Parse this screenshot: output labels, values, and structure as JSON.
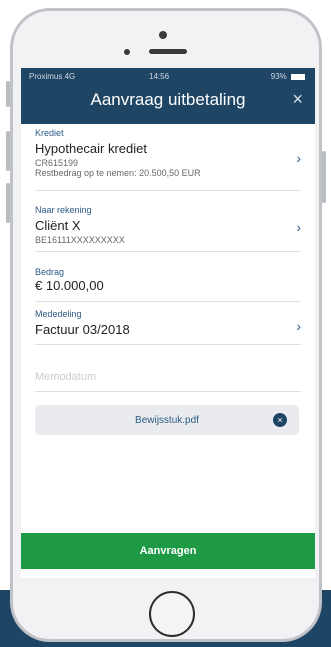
{
  "status_bar": {
    "carrier": "Proximus 4G",
    "time": "14:56",
    "battery": "93%"
  },
  "header": {
    "title": "Aanvraag uitbetaling",
    "close_icon": "×"
  },
  "form": {
    "krediet": {
      "label": "Krediet",
      "value": "Hypothecair krediet",
      "account": "CR615199",
      "remaining": "Restbedrag op te nemen: 20.500,50 EUR"
    },
    "naar_rekening": {
      "label": "Naar rekening",
      "value": "Cliënt X",
      "iban": "BE16111XXXXXXXXX"
    },
    "bedrag": {
      "label": "Bedrag",
      "value": "€ 10.000,00"
    },
    "mededeling": {
      "label": "Mededeling",
      "value": "Factuur 03/2018"
    },
    "memodatum": {
      "placeholder": "Memodatum"
    },
    "attachment": {
      "filename": "Bewijsstuk.pdf",
      "remove_icon": "×"
    }
  },
  "submit_label": "Aanvragen",
  "icons": {
    "chevron": "›"
  },
  "colors": {
    "header": "#1f4565",
    "accent": "#2c5a86",
    "submit": "#1e9a45"
  }
}
